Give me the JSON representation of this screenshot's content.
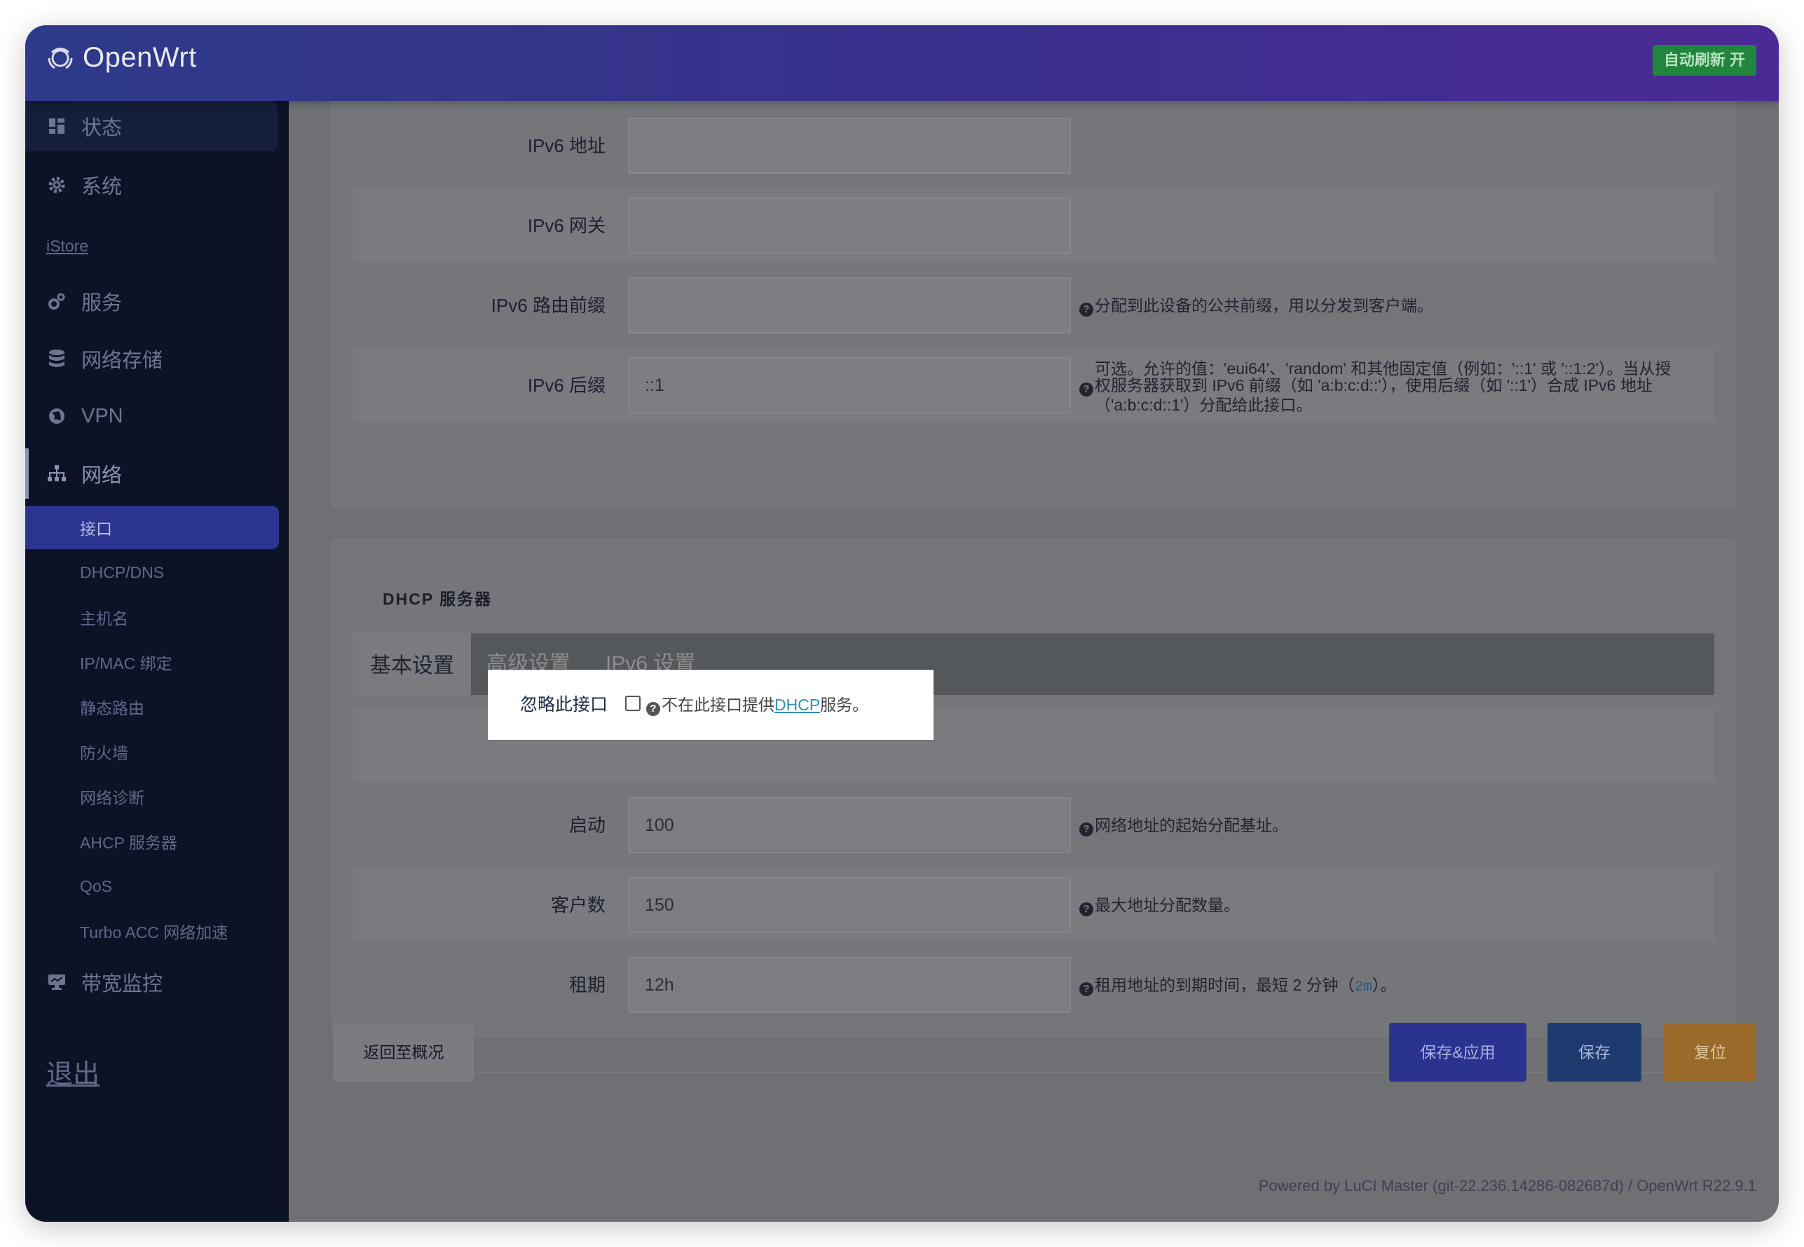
{
  "header": {
    "brand": "OpenWrt",
    "auto_refresh": "自动刷新 开"
  },
  "sidebar": {
    "items": [
      {
        "label": "状态",
        "icon": "dashboard-icon"
      },
      {
        "label": "系统",
        "icon": "gear-icon"
      },
      {
        "label": "服务",
        "icon": "cogs-icon"
      },
      {
        "label": "网络存储",
        "icon": "database-icon"
      },
      {
        "label": "VPN",
        "icon": "globe-icon"
      },
      {
        "label": "网络",
        "icon": "sitemap-icon"
      },
      {
        "label": "带宽监控",
        "icon": "monitor-icon"
      }
    ],
    "istore": "iStore",
    "network_sub": [
      "接口",
      "DHCP/DNS",
      "主机名",
      "IP/MAC 绑定",
      "静态路由",
      "防火墙",
      "网络诊断",
      "AHCP 服务器",
      "QoS",
      "Turbo ACC 网络加速"
    ],
    "logout": "退出"
  },
  "ipv6": {
    "address_label": "IPv6 地址",
    "address_value": "",
    "gateway_label": "IPv6 网关",
    "gateway_value": "",
    "prefix_label": "IPv6 路由前缀",
    "prefix_value": "",
    "prefix_help": "分配到此设备的公共前缀，用以分发到客户端。",
    "suffix_label": "IPv6 后缀",
    "suffix_value": "::1",
    "suffix_help_1": "可选。允许的值：'eui64'、'random' 和其他固定值（例如：'::1' 或 '::1:2'）。当从授",
    "suffix_help_2": "权服务器获取到 IPv6 前缀（如 'a:b:c:d::'），使用后缀（如 '::1'）合成 IPv6 地址",
    "suffix_help_3": "（'a:b:c:d::1'）分配给此接口。"
  },
  "dhcp": {
    "title": "DHCP 服务器",
    "tabs": [
      "基本设置",
      "高级设置",
      "IPv6 设置"
    ],
    "ignore_label": "忽略此接口",
    "ignore_help_pre": "不在此接口提供",
    "ignore_help_link": "DHCP",
    "ignore_help_post": "服务。",
    "start_label": "启动",
    "start_value": "100",
    "start_help": "网络地址的起始分配基址。",
    "limit_label": "客户数",
    "limit_value": "150",
    "limit_help": "最大地址分配数量。",
    "lease_label": "租期",
    "lease_value": "12h",
    "lease_help_pre": "租用地址的到期时间，最短 2 分钟（",
    "lease_help_code": "2m",
    "lease_help_post": "）。"
  },
  "footer": {
    "back": "返回至概况",
    "save_apply": "保存&应用",
    "save": "保存",
    "reset": "复位",
    "powered": "Powered by LuCI Master (git-22.236.14286-082687d) / OpenWrt R22.9.1"
  },
  "colors": {
    "header_start": "#2e3a8a",
    "header_end": "#4a2a94",
    "sidebar_bg": "#0d1326",
    "active_sub": "#2b3590",
    "auto_refresh": "#20853d",
    "save_apply": "#2b3390",
    "save": "#1d3b6f",
    "reset": "#9a6a2a"
  }
}
